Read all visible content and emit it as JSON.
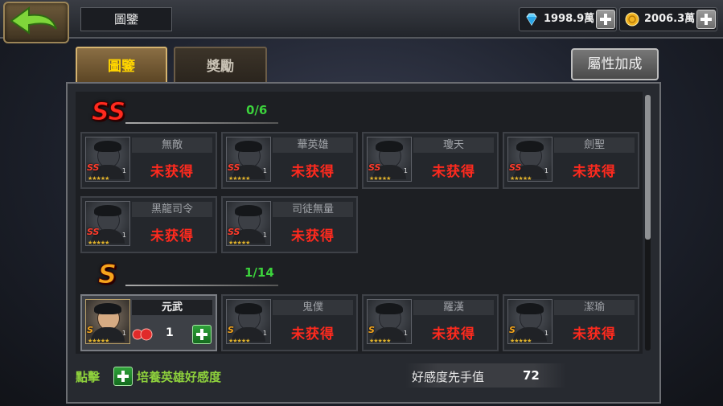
{
  "header": {
    "title": "圖鑒",
    "diamonds": "1998.9萬",
    "gold": "2006.3萬"
  },
  "tabs": [
    {
      "label": "圖鑒",
      "active": true
    },
    {
      "label": "獎勵",
      "active": false
    }
  ],
  "attribute_button": "屬性加成",
  "sections": [
    {
      "rank": "SS",
      "progress": "0/6",
      "heroes": [
        {
          "name": "無敵",
          "status": "未获得",
          "badge": "SS",
          "level": "1",
          "stars": "★★★★★"
        },
        {
          "name": "華英雄",
          "status": "未获得",
          "badge": "SS",
          "level": "1",
          "stars": "★★★★★"
        },
        {
          "name": "瓊天",
          "status": "未获得",
          "badge": "SS",
          "level": "1",
          "stars": "★★★★★"
        },
        {
          "name": "劍聖",
          "status": "未获得",
          "badge": "SS",
          "level": "1",
          "stars": "★★★★★"
        },
        {
          "name": "黑龍司令",
          "status": "未获得",
          "badge": "SS",
          "level": "1",
          "stars": "★★★★★"
        },
        {
          "name": "司徒無量",
          "status": "未获得",
          "badge": "SS",
          "level": "1",
          "stars": "★★★★★"
        }
      ]
    },
    {
      "rank": "S",
      "progress": "1/14",
      "heroes": [
        {
          "name": "元武",
          "owned": true,
          "count": "1",
          "badge": "S",
          "level": "1",
          "stars": "★★★★★"
        },
        {
          "name": "鬼僕",
          "status": "未获得",
          "badge": "S",
          "level": "1",
          "stars": "★★★★★"
        },
        {
          "name": "羅漢",
          "status": "未获得",
          "badge": "S",
          "level": "1",
          "stars": "★★★★★"
        },
        {
          "name": "潔瑜",
          "status": "未获得",
          "badge": "S",
          "level": "1",
          "stars": "★★★★★"
        }
      ]
    }
  ],
  "footer": {
    "hint_prefix": "點擊",
    "hint_suffix": "培養英雄好感度",
    "affinity_label": "好感度先手值",
    "affinity_value": "72"
  },
  "colors": {
    "accent_gold": "#ffd500",
    "status_red": "#ff2a1e",
    "progress_green": "#3cd23c",
    "hint_green": "#8ed13c"
  }
}
